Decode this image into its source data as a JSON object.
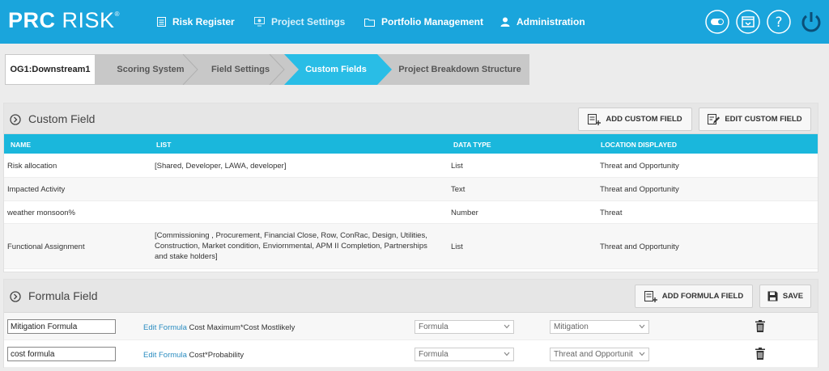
{
  "app": {
    "logo_bold": "PRC",
    "logo_light": "RISK",
    "logo_reg": "®"
  },
  "nav": [
    {
      "label": "Risk Register",
      "icon": "register-icon"
    },
    {
      "label": "Project Settings",
      "icon": "settings-icon"
    },
    {
      "label": "Portfolio Management",
      "icon": "folder-icon"
    },
    {
      "label": "Administration",
      "icon": "user-icon"
    }
  ],
  "toolbar_icons": [
    "toggle-icon",
    "window-icon",
    "help-icon",
    "power-icon"
  ],
  "breadcrumb": {
    "project": "OG1:Downstream1",
    "steps": [
      "Scoring System",
      "Field Settings",
      "Custom Fields",
      "Project Breakdown Structure"
    ],
    "active_index": 2
  },
  "custom_field": {
    "title": "Custom Field",
    "add_label": "ADD CUSTOM FIELD",
    "edit_label": "EDIT CUSTOM FIELD",
    "columns": [
      "NAME",
      "LIST",
      "DATA TYPE",
      "LOCATION DISPLAYED"
    ],
    "rows": [
      {
        "name": "Risk allocation",
        "list": "[Shared, Developer, LAWA, developer]",
        "type": "List",
        "location": "Threat and Opportunity"
      },
      {
        "name": "Impacted Activity",
        "list": "",
        "type": "Text",
        "location": "Threat and Opportunity"
      },
      {
        "name": "weather monsoon%",
        "list": "",
        "type": "Number",
        "location": "Threat"
      },
      {
        "name": "Functional Assignment",
        "list_lines": [
          "[Commissioning , Procurement, Financial Close, Row, ConRac, Design, Utilities,",
          "Construction, Market condition, Enviornmental, APM II Completion, Partnerships",
          "and stake holders]"
        ],
        "type": "List",
        "location": "Threat and Opportunity"
      }
    ]
  },
  "formula_field": {
    "title": "Formula Field",
    "add_label": "ADD FORMULA FIELD",
    "save_label": "SAVE",
    "edit_link": "Edit Formula",
    "rows": [
      {
        "name": "Mitigation Formula",
        "formula": "Cost Maximum*Cost Mostlikely",
        "type": "Formula",
        "location": "Mitigation"
      },
      {
        "name": "cost formula",
        "formula": "Cost*Probability",
        "type": "Formula",
        "location": "Threat and Opportunit"
      }
    ]
  },
  "colors": {
    "topbar": "#1aa5dc",
    "table_header": "#1ab7dc",
    "active_step": "#29bde6",
    "link": "#2a8cc0"
  }
}
